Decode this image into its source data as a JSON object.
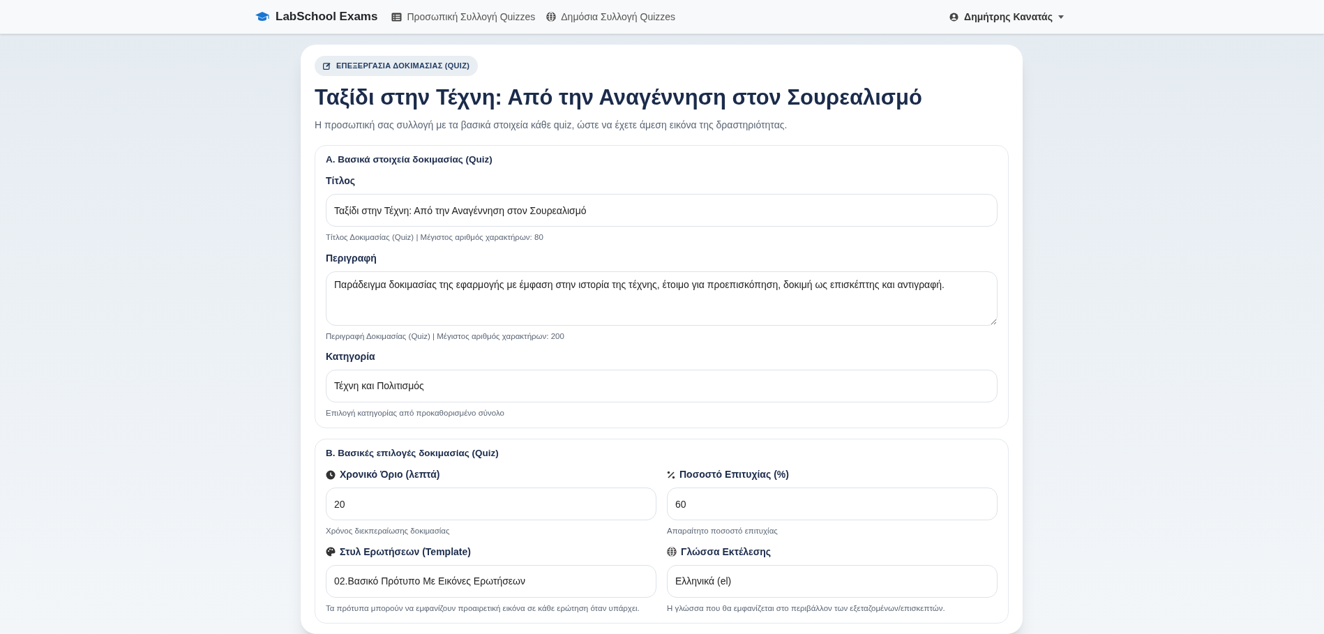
{
  "navbar": {
    "brand": "LabSchool Exams",
    "links": [
      {
        "label": "Προσωπική Συλλογή Quizzes"
      },
      {
        "label": "Δημόσια Συλλογή Quizzes"
      }
    ],
    "user": "Δημήτρης Κανατάς"
  },
  "header": {
    "badge": "ΕΠΕΞΕΡΓΑΣΙΑ ΔΟΚΙΜΑΣΙΑΣ (QUIZ)",
    "title": "Ταξίδι στην Τέχνη: Από την Αναγέννηση στον Σουρεαλισμό",
    "subtitle": "Η προσωπική σας συλλογή με τα βασικά στοιχεία κάθε quiz, ώστε να έχετε άμεση εικόνα της δραστηριότητας."
  },
  "sections": [
    {
      "title": "Α. Βασικά στοιχεία δοκιμασίας (Quiz)",
      "fields": [
        {
          "label": "Τίτλος",
          "kind": "input",
          "value": "Ταξίδι στην Τέχνη: Από την Αναγέννηση στον Σουρεαλισμό",
          "help": "Τίτλος Δοκιμασίας (Quiz) | Μέγιστος αριθμός χαρακτήρων: 80"
        },
        {
          "label": "Περιγραφή",
          "kind": "textarea",
          "value": "Παράδειγμα δοκιμασίας της εφαρμογής με έμφαση στην ιστορία της τέχνης, έτοιμο για προεπισκόπηση, δοκιμή ως επισκέπτης και αντιγραφή.",
          "help": "Περιγραφή Δοκιμασίας (Quiz) | Μέγιστος αριθμός χαρακτήρων: 200"
        },
        {
          "label": "Κατηγορία",
          "kind": "input",
          "value": "Τέχνη και Πολιτισμός",
          "help": "Επιλογή κατηγορίας από προκαθορισμένο σύνολο"
        }
      ]
    },
    {
      "title": "Β. Βασικές επιλογές δοκιμασίας (Quiz)",
      "fields": [
        {
          "label": "Χρονικό Όριο (λεπτά)",
          "kind": "input",
          "value": "20",
          "help": "Χρόνος διεκπεραίωσης δοκιμασίας"
        },
        {
          "label": "Ποσοστό Επιτυχίας (%)",
          "kind": "input",
          "value": "60",
          "help": "Απαραίτητο ποσοστό επιτυχίας"
        },
        {
          "label": "Στυλ Ερωτήσεων (Template)",
          "kind": "input",
          "value": "02.Βασικό Πρότυπο Με Εικόνες Ερωτήσεων",
          "help": "Τα πρότυπα μπορούν να εμφανίζουν προαιρετική εικόνα σε κάθε ερώτηση όταν υπάρχει."
        },
        {
          "label": "Γλώσσα Εκτέλεσης",
          "kind": "input",
          "value": "Ελληνικά (el)",
          "help": "Η γλώσσα που θα εμφανίζεται στο περιβάλλον των εξεταζομένων/επισκεπτών."
        }
      ]
    }
  ]
}
